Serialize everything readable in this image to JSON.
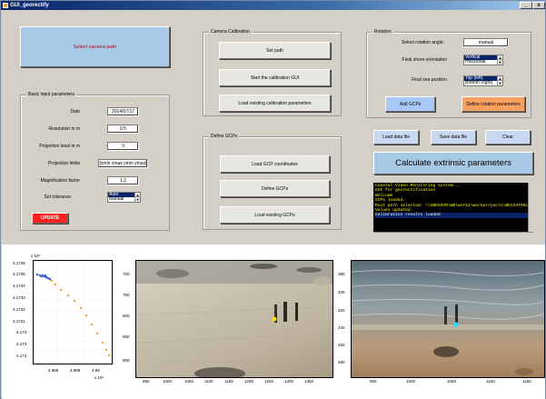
{
  "window": {
    "title": "GUI_georectify",
    "controls": [
      "_",
      "□",
      "x"
    ]
  },
  "camera_path_button": "Select camera path",
  "basic_panel": {
    "title": "Basic input parameters",
    "fields": [
      {
        "label": "Date",
        "value": "2014/07/17"
      },
      {
        "label": "Resolution in m",
        "value": "0.5"
      },
      {
        "label": "Projection level in m",
        "value": "0"
      },
      {
        "label": "Projection limits",
        "value": "[xmin xmax ymin ymax]"
      },
      {
        "label": "Magnification factor",
        "value": "1.2"
      }
    ],
    "tolerance_label": "Set tolerance",
    "tolerance_options": [
      "Auto",
      "Manual"
    ],
    "update_button": "UPDATE"
  },
  "calibration_panel": {
    "title": "Camera Calibration",
    "buttons": [
      "Set path",
      "Start the calibration GUI",
      "Load existing calibration parameters"
    ]
  },
  "gcp_panel": {
    "title": "Define GCPs",
    "buttons": [
      "Load GCP coordinates",
      "Define GCPs",
      "Load existing GCPs"
    ]
  },
  "rotation_panel": {
    "title": "Rotation",
    "angle_label": "Select rotation angle:",
    "angle_value": "manual",
    "shore_label": "Final shore orientation",
    "shore_options": [
      "Vertical",
      "Horizontal"
    ],
    "sea_label": "Final sea position",
    "sea_options": [
      "Top (left)",
      "Bottom (right)"
    ],
    "add_gcps_button": "Add GCPs",
    "define_rotation_button": "Define rotation parameters"
  },
  "file_buttons": {
    "load": "Load data file",
    "save": "Save data file",
    "clear": "Clear"
  },
  "calculate_button": "Calculate extrinsic parameters",
  "console_lines": [
    "Coastal Video Monitoring system...",
    "GUI for georectification",
    "Welcome",
    "GCPs loaded.",
    "Root path selected: \\\\VBOXSVR\\WD\\work2\\workprojects\\BEACHTOOL",
    "Values updated.",
    "Calibration results loaded"
  ],
  "scatter_plot": {
    "x_exponent": "x 10⁵",
    "y_exponent": "x 10⁶",
    "y_ticks": [
      "4.1736",
      "4.1735",
      "4.1734",
      "4.1733",
      "4.1732",
      "4.1731",
      "4.173",
      "4.173",
      "4.173"
    ],
    "x_ticks": [
      "4.988",
      "4.989",
      "4.99"
    ]
  },
  "image_plot_left": {
    "y_ticks": [
      "700",
      "750",
      "800",
      "850",
      "900"
    ],
    "x_ticks": [
      "950",
      "1000",
      "1050",
      "1100",
      "1150",
      "1200",
      "1250",
      "1300",
      "1350"
    ]
  },
  "image_plot_right": {
    "y_ticks": [
      "380",
      "400",
      "420",
      "440",
      "460",
      "480"
    ],
    "x_ticks": [
      "950",
      "1000",
      "1050",
      "1100",
      "1150"
    ]
  },
  "colors": {
    "camera_btn": "#a8c8e8",
    "update_btn": "#ff2020",
    "add_gcps_btn": "#a8c8f8",
    "define_rot_btn": "#f8a060",
    "calc_btn": "#a8c8e8",
    "console_bg": "#000000",
    "console_fg": "#ffff00"
  }
}
